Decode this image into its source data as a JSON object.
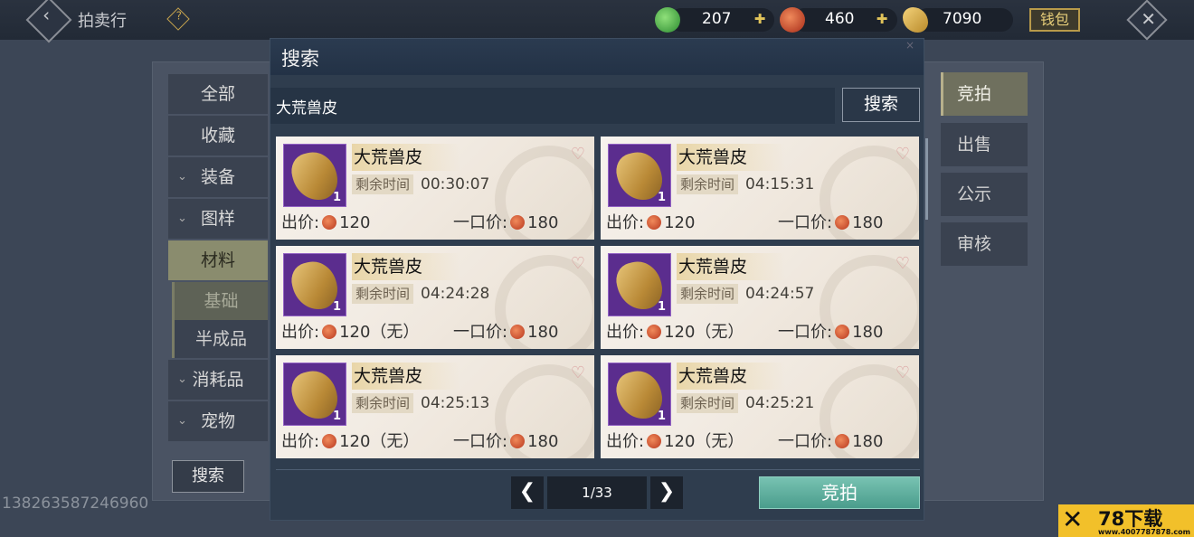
{
  "topbar": {
    "title": "拍卖行",
    "help_icon": "?",
    "currencies": [
      {
        "icon": "jade-coin-icon",
        "value": "207"
      },
      {
        "icon": "red-coin-icon",
        "value": "460"
      },
      {
        "icon": "gold-leaf-icon",
        "value": "7090"
      }
    ],
    "wallet_label": "钱包"
  },
  "sidebar": {
    "items": [
      {
        "label": "全部"
      },
      {
        "label": "收藏"
      },
      {
        "label": "装备"
      },
      {
        "label": "图样"
      },
      {
        "label": "材料"
      },
      {
        "label": "基础"
      },
      {
        "label": "半成品"
      },
      {
        "label": "消耗品"
      },
      {
        "label": "宠物"
      }
    ],
    "search_button": "搜索"
  },
  "right_tabs": [
    "竞拍",
    "出售",
    "公示",
    "审核"
  ],
  "phone_text": "13826358724696​0",
  "dialog": {
    "title": "搜索",
    "query": "大荒兽皮",
    "search_button": "搜索",
    "time_label": "剩余时间",
    "bid_prefix": "出价:",
    "buyout_prefix": "一口价:",
    "items": [
      {
        "name": "大荒兽皮",
        "count": "1",
        "time": "00:30:07",
        "bid": "120",
        "buyout": "180"
      },
      {
        "name": "大荒兽皮",
        "count": "1",
        "time": "04:15:31",
        "bid": "120",
        "buyout": "180"
      },
      {
        "name": "大荒兽皮",
        "count": "1",
        "time": "04:24:28",
        "bid": "120（无）",
        "buyout": "180"
      },
      {
        "name": "大荒兽皮",
        "count": "1",
        "time": "04:24:57",
        "bid": "120（无）",
        "buyout": "180"
      },
      {
        "name": "大荒兽皮",
        "count": "1",
        "time": "04:25:13",
        "bid": "120（无）",
        "buyout": "180"
      },
      {
        "name": "大荒兽皮",
        "count": "1",
        "time": "04:25:21",
        "bid": "120（无）",
        "buyout": "180"
      }
    ],
    "page": "1/33",
    "bid_button": "竞拍"
  },
  "watermark": {
    "brand": "78下载",
    "url": "www.4007787878.com"
  }
}
